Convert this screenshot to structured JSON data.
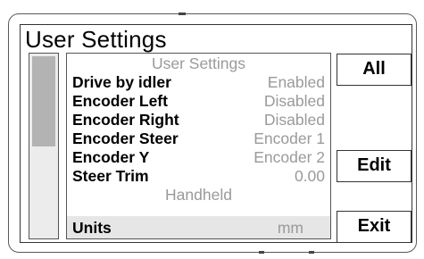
{
  "title": "User Settings",
  "list": {
    "section_header": "User Settings",
    "items": [
      {
        "name": "Drive by idler",
        "value": "Enabled"
      },
      {
        "name": "Encoder Left",
        "value": "Disabled"
      },
      {
        "name": "Encoder Right",
        "value": "Disabled"
      },
      {
        "name": "Encoder Steer",
        "value": "Encoder 1"
      },
      {
        "name": "Encoder Y",
        "value": "Encoder 2"
      },
      {
        "name": "Steer Trim",
        "value": "0.00"
      }
    ],
    "section_header_2": "Handheld",
    "selected_item": {
      "name": "Units",
      "value": "mm"
    }
  },
  "buttons": {
    "all": "All",
    "edit": "Edit",
    "exit": "Exit"
  },
  "scrollbar": {
    "thumb_fraction": 0.5
  }
}
